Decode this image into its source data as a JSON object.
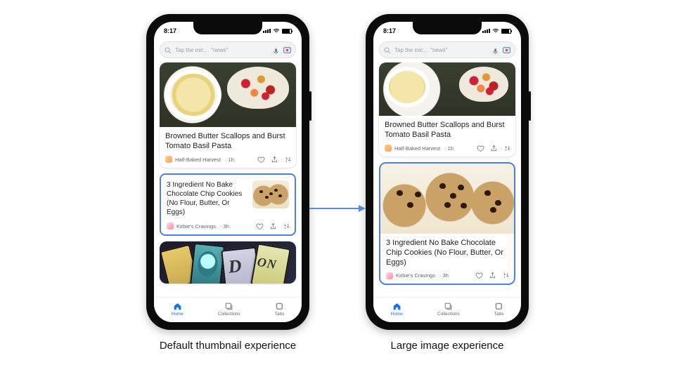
{
  "captions": {
    "left": "Default thumbnail experience",
    "right": "Large image experience"
  },
  "status": {
    "time": "8:17"
  },
  "search": {
    "placeholder": "Tap the mic… \"news\""
  },
  "cards": {
    "pasta": {
      "title": "Browned Butter Scallops and Burst Tomato Basil Pasta",
      "source": "Half-Baked Harvest",
      "age": "1h"
    },
    "cookies": {
      "title": "3 Ingredient No Bake Chocolate Chip Cookies (No Flour, Butter, Or Eggs)",
      "source": "Kirbie's Cravings",
      "age": "3h"
    }
  },
  "nav": {
    "home": "Home",
    "collections": "Collections",
    "tabs": "Tabs"
  },
  "colors": {
    "highlight": "#4f7fe0",
    "arrow": "#5a8bd8",
    "active": "#1a73e8"
  }
}
